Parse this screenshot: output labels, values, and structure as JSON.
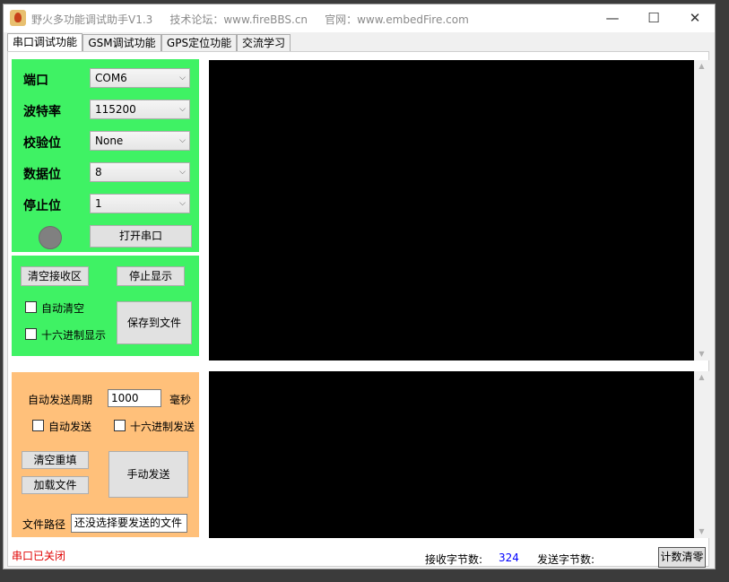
{
  "window": {
    "title": "野火多功能调试助手V1.3     技术论坛：www.fireBBS.cn     官网：www.embedFire.com",
    "minimize_glyph": "—",
    "maximize_glyph": "☐",
    "close_glyph": "✕"
  },
  "tabs": [
    {
      "label": "串口调试功能"
    },
    {
      "label": "GSM调试功能"
    },
    {
      "label": "GPS定位功能"
    },
    {
      "label": "交流学习"
    }
  ],
  "serial": {
    "port_label": "端口",
    "port_value": "COM6",
    "baud_label": "波特率",
    "baud_value": "115200",
    "parity_label": "校验位",
    "parity_value": "None",
    "databits_label": "数据位",
    "databits_value": "8",
    "stopbits_label": "停止位",
    "stopbits_value": "1",
    "open_button": "打开串口",
    "led_color": "#808080"
  },
  "receive": {
    "clear_button": "清空接收区",
    "stop_button": "停止显示",
    "auto_clear_label": "自动清空",
    "hex_display_label": "十六进制显示",
    "save_button": "保存到文件"
  },
  "send": {
    "period_label": "自动发送周期",
    "period_value": "1000",
    "period_unit": "毫秒",
    "auto_send_label": "自动发送",
    "hex_send_label": "十六进制发送",
    "clear_button": "清空重填",
    "load_button": "加载文件",
    "manual_send_button": "手动发送",
    "file_path_label": "文件路径",
    "file_path_value": "还没选择要发送的文件"
  },
  "status": {
    "port_state": "串口已关闭",
    "rx_label": "接收字节数:",
    "rx_value": "324",
    "tx_label": "发送字节数:",
    "tx_value": "",
    "reset_button": "计数清零"
  },
  "colors": {
    "serial_panel": "#3ff264",
    "send_panel": "#ffc07a",
    "port_closed": "#e00000",
    "rx_count": "#0000ff"
  }
}
